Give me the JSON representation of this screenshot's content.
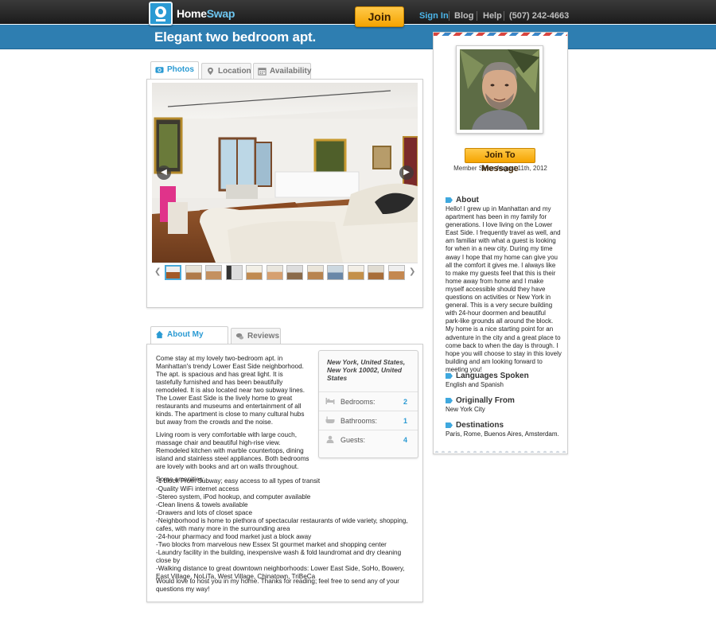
{
  "header": {
    "logo_home": "Home",
    "logo_swap": "Swap",
    "join_label": "Join",
    "nav": {
      "signin": "Sign In",
      "blog": "Blog",
      "help": "Help",
      "phone": "(507) 242-4663"
    }
  },
  "page_title": "Elegant two bedroom apt.",
  "photo_tabs": [
    {
      "label": "Photos"
    },
    {
      "label": "Location"
    },
    {
      "label": "Availability"
    }
  ],
  "home_tabs": [
    {
      "label": "About My Home"
    },
    {
      "label": "Reviews"
    }
  ],
  "about": {
    "p1": "Come stay at my lovely two-bedroom apt. in Manhattan's trendy Lower East Side neighborhood. The apt. is spacious and has great light. It is tastefully furnished and has been beautifully remodeled. It is also located near two subway lines. The Lower East Side is the lively home to great restaurants and museums and entertainment of all kinds. The apartment is close to many cultural hubs but away from the crowds and the noise.",
    "p2": "Living room is very comfortable with large couch, massage chair and beautiful high-rise view. Remodeled kitchen with marble countertops, dining island and stainless steel appliances. Both bedrooms are lovely with books and art on walls throughout.",
    "p3": "Some amenities:",
    "amenities": [
      "-1 block From Subway; easy access to all types of transit",
      "-Quality WiFi internet access",
      "-Stereo system, iPod hookup, and computer available",
      "-Clean linens & towels available",
      "-Drawers and lots of closet space",
      "-Neighborhood is home to plethora of spectacular restaurants of wide variety, shopping, cafes, with many more in the surrounding area",
      "-24-hour pharmacy and food market just a block away",
      "-Two blocks from marvelous new Essex St gourmet market and shopping center",
      "-Laundry facility in the building, inexpensive wash & fold laundromat and dry cleaning close by",
      "-Walking distance to great downtown neighborhoods: Lower East Side, SoHo, Bowery, East Village, NoLiTa, West Village, Chinatown, TriBeCa"
    ],
    "closing": "Would love to host you in my home. Thanks for reading; feel free to send any of your questions my way!"
  },
  "location": {
    "address": "New York, United States, New York 10002, United States",
    "rows": [
      {
        "label": "Bedrooms:",
        "value": "2",
        "icon": "bed-icon"
      },
      {
        "label": "Bathrooms:",
        "value": "1",
        "icon": "bathtub-icon"
      },
      {
        "label": "Guests:",
        "value": "4",
        "icon": "person-icon"
      }
    ]
  },
  "host": {
    "message_label": "Join To Message",
    "member_since": "Member Since August 11th, 2012",
    "about_title": "About",
    "about_text": "Hello! I grew up in Manhattan and my apartment has been in my family for generations. I love living on the Lower East Side. I frequently travel as well, and am familiar with what a guest is looking for when in a new city. During my time away I hope that my home can give you all the comfort it gives me. I always like to make my guests feel that this is their home away from home and I make myself accessible should they have questions on activities or New York in general. This is a very secure building with 24-hour doormen and beautiful park-like grounds all around the block. My home is a nice starting point for an adventure in the city and a great place to come back to when the day is through. I hope you will choose to stay in this lovely building and am looking forward to meeting you!",
    "languages_title": "Languages Spoken",
    "languages": "English and Spanish",
    "origin_title": "Originally From",
    "origin": "New York City",
    "destinations_title": "Destinations",
    "destinations": "Paris, Rome, Buenos Aires, Amsterdam."
  },
  "colors": {
    "brand_blue": "#2e7eb1",
    "accent": "#2a9ad3",
    "join_orange": "#f5a400"
  }
}
